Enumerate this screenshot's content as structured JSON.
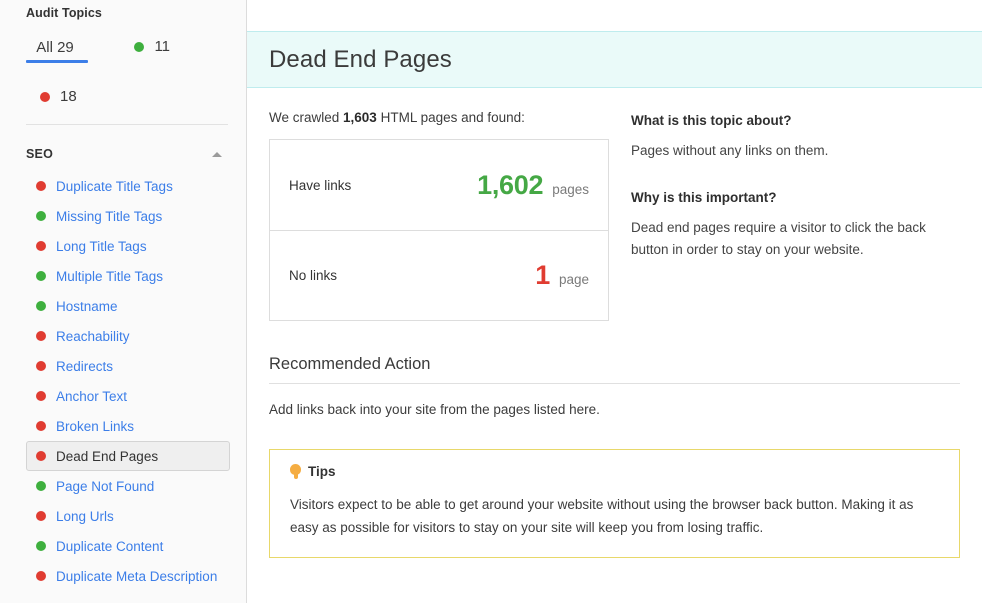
{
  "sidebar": {
    "title": "Audit Topics",
    "tabs": [
      {
        "id": "all",
        "label": "All 29",
        "active": true
      },
      {
        "id": "green",
        "count": "11",
        "dot": "green-dot",
        "active": false
      },
      {
        "id": "red",
        "count": "18",
        "dot": "red-dot",
        "active": false
      }
    ],
    "group": {
      "label": "SEO",
      "collapse_icon": "caret-up-icon",
      "expanded": true
    },
    "topics": [
      {
        "label": "Duplicate Title Tags",
        "status": "red",
        "active": false
      },
      {
        "label": "Missing Title Tags",
        "status": "green",
        "active": false
      },
      {
        "label": "Long Title Tags",
        "status": "red",
        "active": false
      },
      {
        "label": "Multiple Title Tags",
        "status": "green",
        "active": false
      },
      {
        "label": "Hostname",
        "status": "green",
        "active": false
      },
      {
        "label": "Reachability",
        "status": "red",
        "active": false
      },
      {
        "label": "Redirects",
        "status": "red",
        "active": false
      },
      {
        "label": "Anchor Text",
        "status": "red",
        "active": false
      },
      {
        "label": "Broken Links",
        "status": "red",
        "active": false
      },
      {
        "label": "Dead End Pages",
        "status": "red",
        "active": true
      },
      {
        "label": "Page Not Found",
        "status": "green",
        "active": false
      },
      {
        "label": "Long Urls",
        "status": "red",
        "active": false
      },
      {
        "label": "Duplicate Content",
        "status": "green",
        "active": false
      },
      {
        "label": "Duplicate Meta Description",
        "status": "red",
        "active": false
      }
    ]
  },
  "main": {
    "page_title": "Dead End Pages",
    "crawl": {
      "prefix": "We crawled ",
      "count": "1,603",
      "suffix": " HTML pages and found:"
    },
    "stats": [
      {
        "label": "Have links",
        "value": "1,602",
        "unit": "pages",
        "color": "green"
      },
      {
        "label": "No links",
        "value": "1",
        "unit": "page",
        "color": "red"
      }
    ],
    "info": [
      {
        "question": "What is this topic about?",
        "answer": "Pages without any links on them."
      },
      {
        "question": "Why is this important?",
        "answer": "Dead end pages require a visitor to click the back button in order to stay on your website."
      }
    ],
    "recommended": {
      "title": "Recommended Action",
      "text": "Add links back into your site from the pages listed here."
    },
    "tips": {
      "icon": "lightbulb-icon",
      "label": "Tips",
      "text": "Visitors expect to be able to get around your website without using the browser back button. Making it as easy as possible for visitors to stay on your site will keep you from losing traffic."
    }
  },
  "colors": {
    "link": "#3c7ee8",
    "status_green": "#3eaf3e",
    "status_red": "#e03c31",
    "value_green": "#45a845",
    "value_red": "#e03c31",
    "header_bg": "#eafaf9",
    "header_border": "#bfecee",
    "tips_border": "#e8d86a",
    "tab_underline": "#3c7ee8"
  }
}
